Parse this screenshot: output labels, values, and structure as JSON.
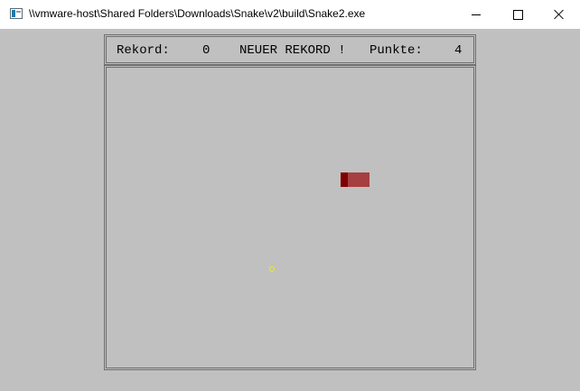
{
  "window": {
    "title": "\\\\vmware-host\\Shared Folders\\Downloads\\Snake\\v2\\build\\Snake2.exe"
  },
  "scorebar": {
    "rekord_label": "Rekord:",
    "rekord_value": "0",
    "message": "NEUER REKORD !",
    "punkte_label": "Punkte:",
    "punkte_value": "4"
  },
  "game": {
    "snake_length": 4,
    "snake_head_color": "#800000",
    "snake_body_color": "#c8a8a8",
    "food_color": "#f0f000",
    "background_color": "#c0c0c0"
  }
}
